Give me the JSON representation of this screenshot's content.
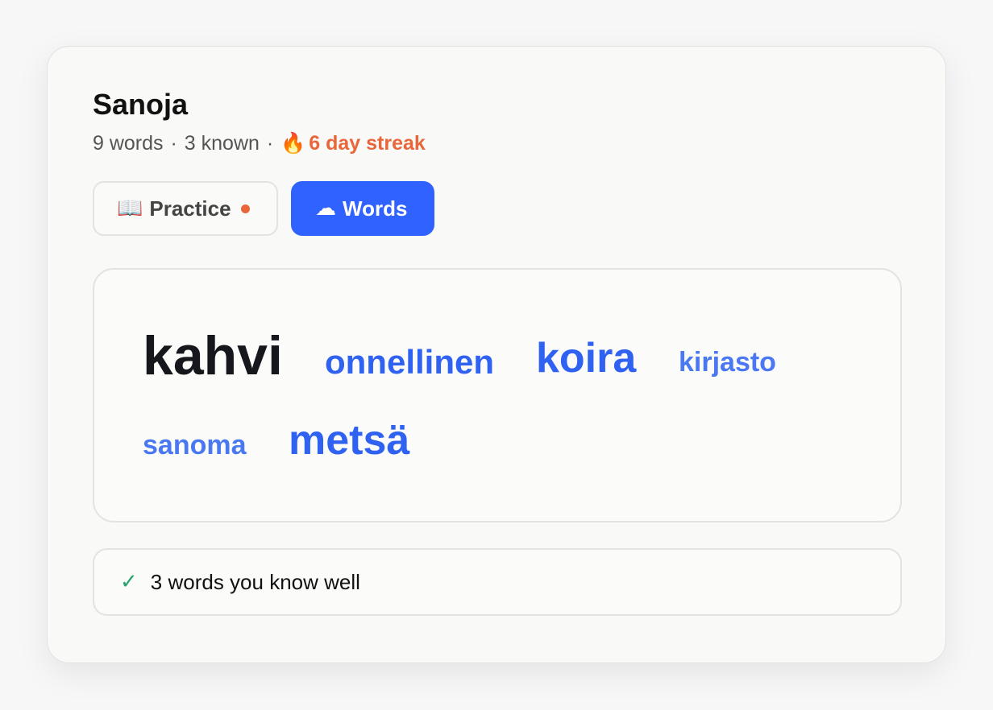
{
  "app": {
    "title": "Sanoja"
  },
  "stats": {
    "words": "9 words",
    "separator": "·",
    "known": "3 known",
    "streak_icon": "🔥",
    "streak": "6 day streak"
  },
  "tabs": [
    {
      "icon": "📖",
      "icon_name": "book-icon",
      "label": "Practice",
      "has_notification": true,
      "active": false
    },
    {
      "icon": "☁",
      "icon_name": "cloud-icon",
      "label": "Words",
      "active": true
    }
  ],
  "word_cloud": {
    "words": [
      {
        "text": "kahvi",
        "known": true
      },
      {
        "text": "onnellinen"
      },
      {
        "text": "koira"
      },
      {
        "text": "kirjasto"
      },
      {
        "text": "sanoma"
      },
      {
        "text": "metsä"
      }
    ]
  },
  "known_summary": {
    "icon": "✓",
    "icon_name": "check-icon",
    "text": "3 words you know well"
  },
  "colors": {
    "accent": "#2f62ff",
    "streak": "#e8663a",
    "check": "#2aa36b",
    "known_word": "#15171c"
  }
}
